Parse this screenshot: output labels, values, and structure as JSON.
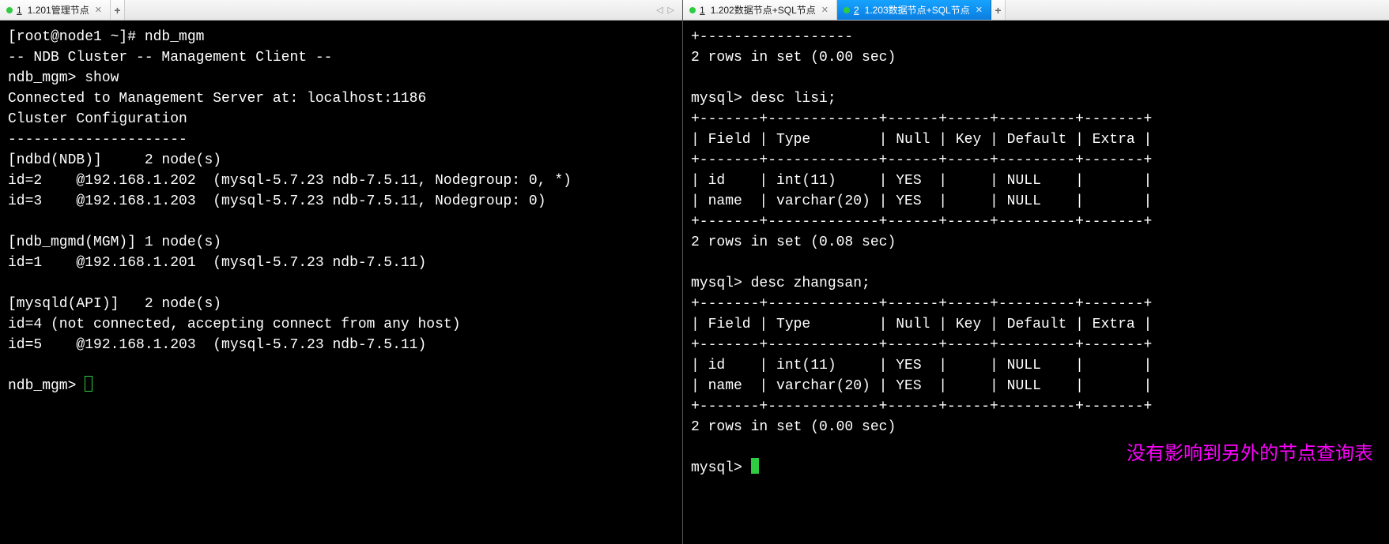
{
  "left": {
    "tab": {
      "index": "1",
      "label": "1.201管理节点"
    },
    "lines": [
      "[root@node1 ~]# ndb_mgm",
      "-- NDB Cluster -- Management Client --",
      "ndb_mgm> show",
      "Connected to Management Server at: localhost:1186",
      "Cluster Configuration",
      "---------------------",
      "[ndbd(NDB)]     2 node(s)",
      "id=2    @192.168.1.202  (mysql-5.7.23 ndb-7.5.11, Nodegroup: 0, *)",
      "id=3    @192.168.1.203  (mysql-5.7.23 ndb-7.5.11, Nodegroup: 0)",
      "",
      "[ndb_mgmd(MGM)] 1 node(s)",
      "id=1    @192.168.1.201  (mysql-5.7.23 ndb-7.5.11)",
      "",
      "[mysqld(API)]   2 node(s)",
      "id=4 (not connected, accepting connect from any host)",
      "id=5    @192.168.1.203  (mysql-5.7.23 ndb-7.5.11)",
      "",
      "ndb_mgm> "
    ]
  },
  "right": {
    "tabs": [
      {
        "index": "1",
        "label": "1.202数据节点+SQL节点",
        "active": false
      },
      {
        "index": "2",
        "label": "1.203数据节点+SQL节点",
        "active": true
      }
    ],
    "lines": [
      "+------------------",
      "2 rows in set (0.00 sec)",
      "",
      "mysql> desc lisi;",
      "+-------+-------------+------+-----+---------+-------+",
      "| Field | Type        | Null | Key | Default | Extra |",
      "+-------+-------------+------+-----+---------+-------+",
      "| id    | int(11)     | YES  |     | NULL    |       |",
      "| name  | varchar(20) | YES  |     | NULL    |       |",
      "+-------+-------------+------+-----+---------+-------+",
      "2 rows in set (0.08 sec)",
      "",
      "mysql> desc zhangsan;",
      "+-------+-------------+------+-----+---------+-------+",
      "| Field | Type        | Null | Key | Default | Extra |",
      "+-------+-------------+------+-----+---------+-------+",
      "| id    | int(11)     | YES  |     | NULL    |       |",
      "| name  | varchar(20) | YES  |     | NULL    |       |",
      "+-------+-------------+------+-----+---------+-------+",
      "2 rows in set (0.00 sec)",
      "",
      "mysql> "
    ],
    "annotation": "没有影响到另外的节点查询表"
  }
}
